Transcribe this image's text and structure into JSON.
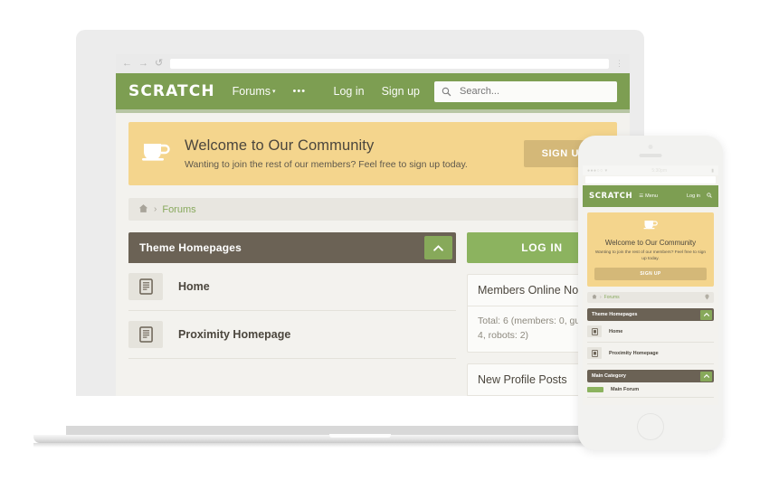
{
  "browser": {
    "back_icon": "arrow-left-icon",
    "forward_icon": "arrow-right-icon",
    "reload_icon": "reload-icon",
    "url_value": "",
    "menu_icon": "kebab-menu-icon"
  },
  "desktop": {
    "nav": {
      "brand": "SCRATCH",
      "forums_label": "Forums",
      "caret": "▾",
      "overflow_label": "•••",
      "login_label": "Log in",
      "signup_label": "Sign up",
      "search_placeholder": "Search...",
      "search_value": "",
      "search_icon": "search-icon"
    },
    "welcome": {
      "icon": "coffee-cup-icon",
      "title": "Welcome to Our Community",
      "subtitle": "Wanting to join the rest of our members? Feel free to sign up today.",
      "button_label": "SIGN UP"
    },
    "breadcrumb": {
      "home_icon": "home-icon",
      "separator": "›",
      "forums_label": "Forums",
      "pin_icon": "location-pin-icon"
    },
    "category": {
      "title": "Theme Homepages",
      "toggle_icon": "chevron-up-icon"
    },
    "forums": [
      {
        "title": "Home",
        "icon": "document-icon"
      },
      {
        "title": "Proximity Homepage",
        "icon": "document-icon"
      }
    ],
    "login_button": "LOG IN",
    "widgets": [
      {
        "title": "Members Online Now",
        "body": "Total: 6 (members: 0, guests: 4, robots: 2)"
      },
      {
        "title": "New Profile Posts",
        "body": ""
      }
    ]
  },
  "phone": {
    "status": {
      "signal": "●●●○○",
      "wifi_icon": "wifi-icon",
      "time": "5:30pm",
      "battery_icon": "battery-icon"
    },
    "nav": {
      "brand": "SCRATCH",
      "menu_icon": "hamburger-menu-icon",
      "menu_label": "Menu",
      "login_label": "Log in",
      "search_icon": "search-icon"
    },
    "welcome": {
      "icon": "coffee-cup-icon",
      "title": "Welcome to Our Community",
      "subtitle": "Wanting to join the rest of our members? Feel free to sign up today.",
      "button_label": "SIGN UP"
    },
    "breadcrumb": {
      "home_icon": "home-icon",
      "separator": "›",
      "forums_label": "Forums",
      "pin_icon": "location-pin-icon"
    },
    "sections": [
      {
        "title": "Theme Homepages",
        "toggle_icon": "chevron-up-icon",
        "items": [
          {
            "title": "Home",
            "icon": "document-icon"
          },
          {
            "title": "Proximity Homepage",
            "icon": "document-icon"
          }
        ]
      },
      {
        "title": "Main Category",
        "toggle_icon": "chevron-up-icon",
        "items": [
          {
            "title": "Main Forum",
            "icon": "green-bar-icon"
          }
        ]
      }
    ]
  },
  "colors": {
    "green": "#7d9e52",
    "light_green": "#8cb35f",
    "yellow": "#f4d58d",
    "gold": "#d4b878",
    "brown": "#6b6255",
    "page_bg": "#f3f2ee"
  }
}
